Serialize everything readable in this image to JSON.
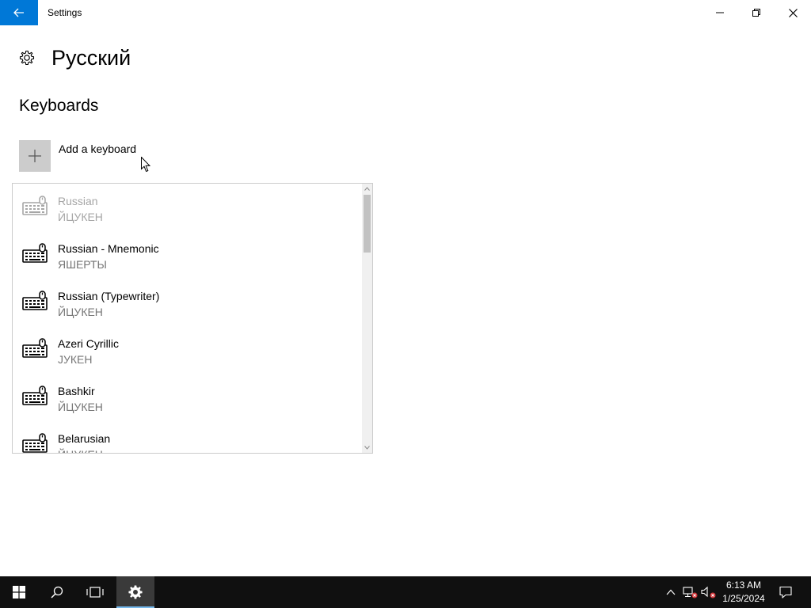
{
  "window": {
    "title": "Settings",
    "accent_color": "#0078d7"
  },
  "page": {
    "title": "Русский",
    "section_title": "Keyboards",
    "add_keyboard_label": "Add a keyboard"
  },
  "keyboard_list": {
    "items": [
      {
        "name": "Russian",
        "layout": "ЙЦУКЕН",
        "disabled": true
      },
      {
        "name": "Russian - Mnemonic",
        "layout": "ЯШЕРТЫ",
        "disabled": false
      },
      {
        "name": "Russian (Typewriter)",
        "layout": "ЙЦУКЕН",
        "disabled": false
      },
      {
        "name": "Azeri Cyrillic",
        "layout": "ЈУКЕН",
        "disabled": false
      },
      {
        "name": "Bashkir",
        "layout": "ЙЦУКЕН",
        "disabled": false
      },
      {
        "name": "Belarusian",
        "layout": "ЙЦУКЕН",
        "disabled": false
      }
    ]
  },
  "taskbar": {
    "time": "6:13 AM",
    "date": "1/25/2024",
    "pinned": [
      "start-icon",
      "search-icon",
      "task-view-icon",
      "settings-icon"
    ],
    "tray": [
      "chevron-up-icon",
      "network-icon",
      "volume-muted-icon",
      "notification-icon"
    ]
  }
}
